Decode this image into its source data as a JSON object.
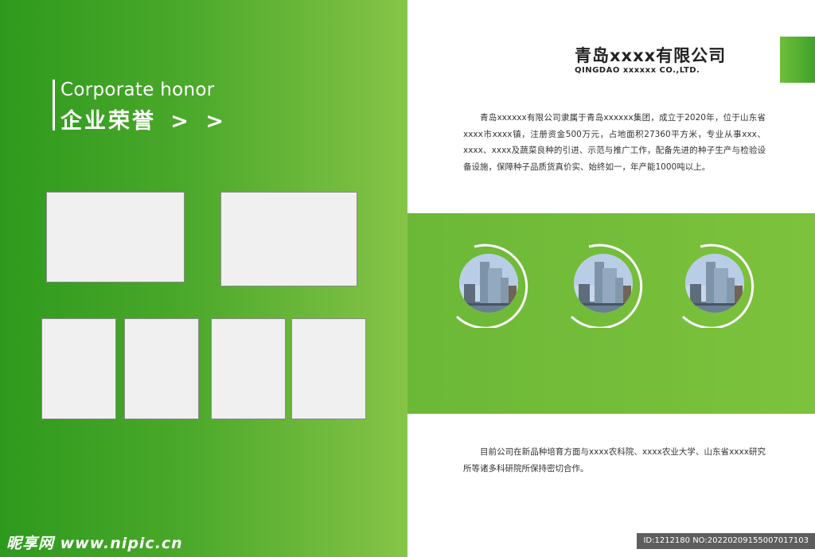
{
  "left_page": {
    "title_en": "Corporate honor",
    "title_cn": "企业荣誉",
    "title_arrows": "> >"
  },
  "right_page": {
    "company_name": "青岛xxxx有限公司",
    "company_name_en": "QINGDAO xxxxxx CO.,LTD.",
    "intro": "青岛xxxxxx有限公司隶属于青岛xxxxxx集团，成立于2020年，位于山东省xxxx市xxxx镇，注册资金500万元，占地面积27360平方米，专业从事xxx、xxxx、xxxx及蔬菜良种的引进、示范与推广工作，配备先进的种子生产与检验设备设施，保障种子品质货真价实、始终如一，年产能1000吨以上。",
    "cooperation": "目前公司在新品种培育方面与xxxx农科院、xxxx农业大学、山东省xxxx研究所等诸多科研院所保持密切合作。"
  },
  "watermark": {
    "site": "昵享网 www.nipic.cn",
    "id_text": "ID:1212180 NO:20220209155007017103"
  },
  "colors": {
    "brand_green": "#4aa82a",
    "light_green": "#7dc23c"
  }
}
